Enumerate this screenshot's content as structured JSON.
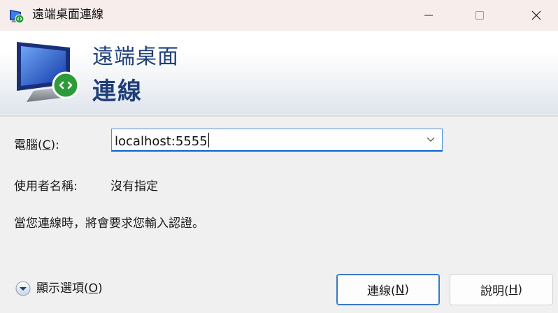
{
  "window": {
    "title": "遠端桌面連線",
    "controls": [
      "minimize",
      "maximize",
      "close"
    ],
    "icon": "remote-desktop-icon"
  },
  "banner": {
    "line1": "遠端桌面",
    "line2": "連線",
    "icon": "monitor-remote-icon",
    "text_color": "#1f3f7a"
  },
  "form": {
    "computer_label_prefix": "電腦(",
    "computer_label_key": "C",
    "computer_label_suffix": "):",
    "computer_value": "localhost:5555",
    "user_label": "使用者名稱:",
    "user_value": "沒有指定",
    "note": "當您連線時，將會要求您輸入認證。"
  },
  "footer": {
    "options_prefix": "顯示選項(",
    "options_key": "O",
    "options_suffix": ")",
    "connect_prefix": "連線(",
    "connect_key": "N",
    "connect_suffix": ")",
    "help_prefix": "說明(",
    "help_key": "H",
    "help_suffix": ")"
  },
  "colors": {
    "accent": "#0a64c8",
    "titlebar": "#f7eeec",
    "background": "#f0f0f0"
  }
}
